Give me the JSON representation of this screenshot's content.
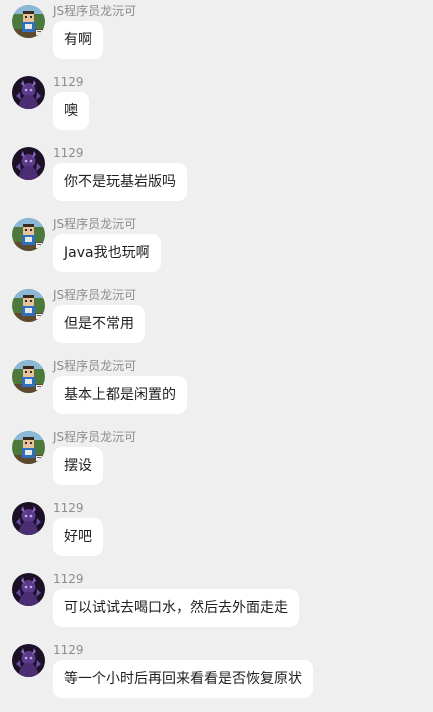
{
  "messages": [
    {
      "sender": "JS程序员龙沅可",
      "text": "有啊",
      "avatar": "pixel-character-avatar"
    },
    {
      "sender": "1129",
      "text": "噢",
      "avatar": "purple-dark-avatar"
    },
    {
      "sender": "1129",
      "text": "你不是玩基岩版吗",
      "avatar": "purple-dark-avatar"
    },
    {
      "sender": "JS程序员龙沅可",
      "text": "Java我也玩啊",
      "avatar": "pixel-character-avatar"
    },
    {
      "sender": "JS程序员龙沅可",
      "text": "但是不常用",
      "avatar": "pixel-character-avatar"
    },
    {
      "sender": "JS程序员龙沅可",
      "text": "基本上都是闲置的",
      "avatar": "pixel-character-avatar"
    },
    {
      "sender": "JS程序员龙沅可",
      "text": "摆设",
      "avatar": "pixel-character-avatar"
    },
    {
      "sender": "1129",
      "text": "好吧",
      "avatar": "purple-dark-avatar"
    },
    {
      "sender": "1129",
      "text": "可以试试去喝口水，然后去外面走走",
      "avatar": "purple-dark-avatar"
    },
    {
      "sender": "1129",
      "text": "等一个小时后再回来看看是否恢复原状",
      "avatar": "purple-dark-avatar"
    }
  ],
  "colors": {
    "background": "#efefef",
    "bubble": "#ffffff",
    "sender": "#8c8c8c",
    "text": "#1f1f1f"
  }
}
